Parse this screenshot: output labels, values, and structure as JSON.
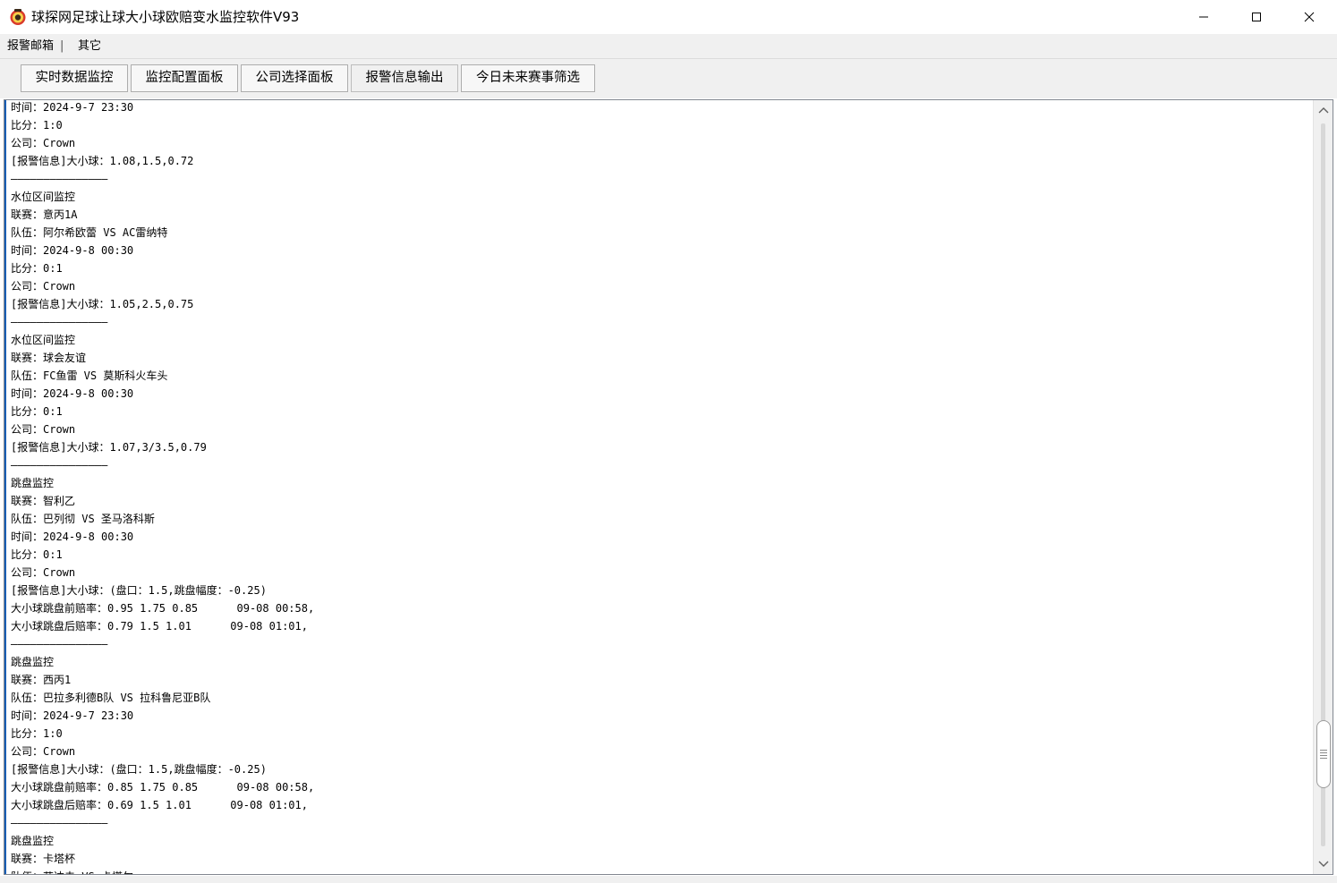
{
  "window": {
    "title": "球探网足球让球大小球欧赔变水监控软件V93",
    "controls": {
      "minimize": "minimize",
      "maximize": "maximize",
      "close": "close"
    }
  },
  "menu": {
    "items": [
      "报警邮箱",
      "其它"
    ],
    "separator": "|"
  },
  "tabs": [
    {
      "label": "实时数据监控",
      "active": false
    },
    {
      "label": "监控配置面板",
      "active": false
    },
    {
      "label": "公司选择面板",
      "active": false
    },
    {
      "label": "报警信息输出",
      "active": true
    },
    {
      "label": "今日未来赛事筛选",
      "active": false
    }
  ],
  "log": [
    "时间：2024-9-7 23:30",
    "比分：1:0",
    "公司：Crown",
    "[报警信息]大小球：1.08,1.5,0.72",
    "———————————————",
    "水位区间监控",
    "联赛：意丙1A",
    "队伍：阿尔希欧蕾 VS AC雷纳特",
    "时间：2024-9-8 00:30",
    "比分：0:1",
    "公司：Crown",
    "[报警信息]大小球：1.05,2.5,0.75",
    "———————————————",
    "水位区间监控",
    "联赛：球会友谊",
    "队伍：FC鱼雷 VS 莫斯科火车头",
    "时间：2024-9-8 00:30",
    "比分：0:1",
    "公司：Crown",
    "[报警信息]大小球：1.07,3/3.5,0.79",
    "———————————————",
    "跳盘监控",
    "联赛：智利乙",
    "队伍：巴列彻 VS 圣马洛科斯",
    "时间：2024-9-8 00:30",
    "比分：0:1",
    "公司：Crown",
    "[报警信息]大小球：(盘口：1.5,跳盘幅度：-0.25)",
    "大小球跳盘前赔率：0.95 1.75 0.85      09-08 00:58,",
    "大小球跳盘后赔率：0.79 1.5 1.01      09-08 01:01,",
    "———————————————",
    "跳盘监控",
    "联赛：西丙1",
    "队伍：巴拉多利德B队 VS 拉科鲁尼亚B队",
    "时间：2024-9-7 23:30",
    "比分：1:0",
    "公司：Crown",
    "[报警信息]大小球：(盘口：1.5,跳盘幅度：-0.25)",
    "大小球跳盘前赔率：0.85 1.75 0.85      09-08 00:58,",
    "大小球跳盘后赔率：0.69 1.5 1.01      09-08 01:01,",
    "———————————————",
    "跳盘监控",
    "联赛：卡塔杯",
    "队伍：艾达夫 VS 卡塔尔"
  ],
  "scroll": {
    "position_fraction": 0.86
  },
  "colors": {
    "accent": "#1a5fb4",
    "chrome": "#f0f0f0",
    "button_border": "#adadad"
  }
}
